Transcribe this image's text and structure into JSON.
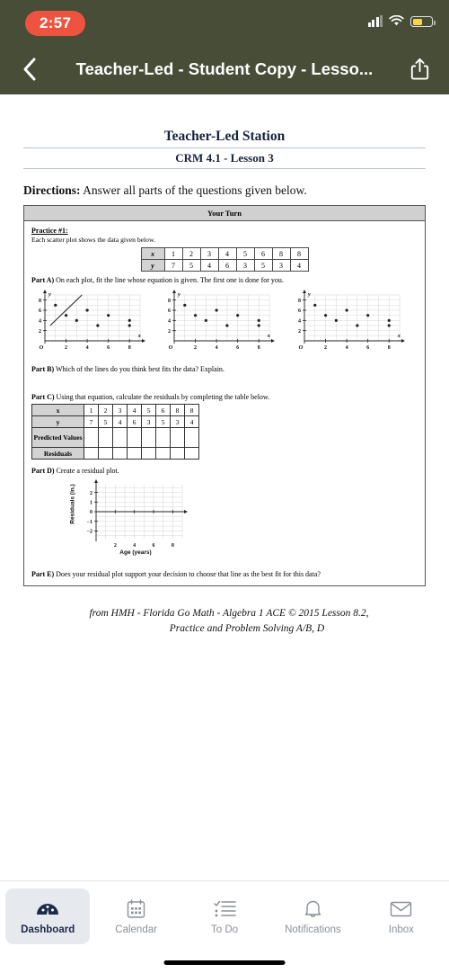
{
  "status_bar": {
    "time": "2:57",
    "time_pill_color": "#ee5340",
    "signal_icon": "cellular-signal-icon",
    "wifi_icon": "wifi-icon",
    "battery_icon": "battery-low-power-icon",
    "battery_color": "#f5d547"
  },
  "nav": {
    "back_icon": "chevron-left-icon",
    "title": "Teacher-Led - Student Copy - Lesso...",
    "share_icon": "share-icon",
    "bar_color": "#474d37"
  },
  "document": {
    "title": "Teacher-Led Station",
    "subtitle": "CRM 4.1 - Lesson 3",
    "directions_label": "Directions:",
    "directions_text": "Answer all parts of the questions given below.",
    "box_header": "Your Turn",
    "practice_label": "Practice #1:",
    "practice_desc": "Each scatter plot shows the data given below.",
    "data_table": {
      "row_x_label": "x",
      "row_y_label": "y",
      "x": [
        "1",
        "2",
        "3",
        "4",
        "5",
        "6",
        "8",
        "8"
      ],
      "y": [
        "7",
        "5",
        "4",
        "6",
        "3",
        "5",
        "3",
        "4"
      ]
    },
    "part_a": {
      "label": "Part A)",
      "text": "On each plot, fit the line whose equation is given.  The first one is done for you."
    },
    "part_b": {
      "label": "Part B)",
      "text": "Which of the lines do you think best fits the data?  Explain."
    },
    "part_c": {
      "label": "Part C)",
      "text": "Using that equation, calculate the residuals by completing the table below.",
      "row_labels": [
        "x",
        "y",
        "Predicted Values",
        "Residuals"
      ],
      "x": [
        "1",
        "2",
        "3",
        "4",
        "5",
        "6",
        "8",
        "8"
      ],
      "y": [
        "7",
        "5",
        "4",
        "6",
        "3",
        "5",
        "3",
        "4"
      ],
      "predicted_values": [
        "",
        "",
        "",
        "",
        "",
        "",
        "",
        ""
      ],
      "residuals": [
        "",
        "",
        "",
        "",
        "",
        "",
        "",
        ""
      ]
    },
    "part_d": {
      "label": "Part D)",
      "text": "Create a residual plot."
    },
    "part_e": {
      "label": "Part E)",
      "text": "Does your residual plot support your decision to choose that line as the best fit for this data?"
    },
    "attribution_line1": "from HMH - Florida Go Math - Algebra 1 ACE © 2015  Lesson 8.2,",
    "attribution_line2": "Practice and Problem Solving A/B, D"
  },
  "chart_data": [
    {
      "type": "scatter",
      "title": "Scatter plot 1 (line of fit drawn)",
      "xlabel": "x",
      "ylabel": "y",
      "x": [
        1,
        2,
        3,
        4,
        5,
        6,
        8,
        8
      ],
      "y": [
        7,
        5,
        4,
        6,
        3,
        5,
        3,
        4
      ],
      "xlim": [
        0,
        9
      ],
      "ylim": [
        0,
        9
      ],
      "xticks": [
        2,
        4,
        6,
        8
      ],
      "yticks": [
        2,
        4,
        6,
        8
      ],
      "grid": true,
      "fit_line": {
        "drawn": true,
        "from": [
          0.5,
          3
        ],
        "to": [
          3.5,
          9
        ]
      }
    },
    {
      "type": "scatter",
      "title": "Scatter plot 2",
      "xlabel": "x",
      "ylabel": "y",
      "x": [
        1,
        2,
        3,
        4,
        5,
        6,
        8,
        8
      ],
      "y": [
        7,
        5,
        4,
        6,
        3,
        5,
        3,
        4
      ],
      "xlim": [
        0,
        9
      ],
      "ylim": [
        0,
        9
      ],
      "xticks": [
        2,
        4,
        6,
        8
      ],
      "yticks": [
        2,
        4,
        6,
        8
      ],
      "grid": true,
      "fit_line": {
        "drawn": false
      }
    },
    {
      "type": "scatter",
      "title": "Scatter plot 3",
      "xlabel": "x",
      "ylabel": "y",
      "x": [
        1,
        2,
        3,
        4,
        5,
        6,
        8,
        8
      ],
      "y": [
        7,
        5,
        4,
        6,
        3,
        5,
        3,
        4
      ],
      "xlim": [
        0,
        9
      ],
      "ylim": [
        0,
        9
      ],
      "xticks": [
        2,
        4,
        6,
        8
      ],
      "yticks": [
        2,
        4,
        6,
        8
      ],
      "grid": true,
      "fit_line": {
        "drawn": false
      }
    },
    {
      "type": "scatter",
      "title": "Residual plot (blank)",
      "xlabel": "Age (years)",
      "ylabel": "Residuals (in.)",
      "x": [],
      "y": [],
      "xlim": [
        0,
        9
      ],
      "ylim": [
        -2.8,
        2.8
      ],
      "xticks": [
        2,
        4,
        6,
        8
      ],
      "yticks": [
        -2,
        -1,
        0,
        1,
        2
      ],
      "grid": true
    }
  ],
  "tabbar": {
    "items": [
      {
        "label": "Dashboard",
        "icon": "dashboard-speedometer-icon",
        "active": true
      },
      {
        "label": "Calendar",
        "icon": "calendar-icon",
        "active": false
      },
      {
        "label": "To Do",
        "icon": "checklist-icon",
        "active": false
      },
      {
        "label": "Notifications",
        "icon": "bell-icon",
        "active": false
      },
      {
        "label": "Inbox",
        "icon": "envelope-icon",
        "active": false
      }
    ],
    "active_color": "#1d2b4a",
    "inactive_color": "#8b9099",
    "home_indicator": "home-indicator"
  }
}
